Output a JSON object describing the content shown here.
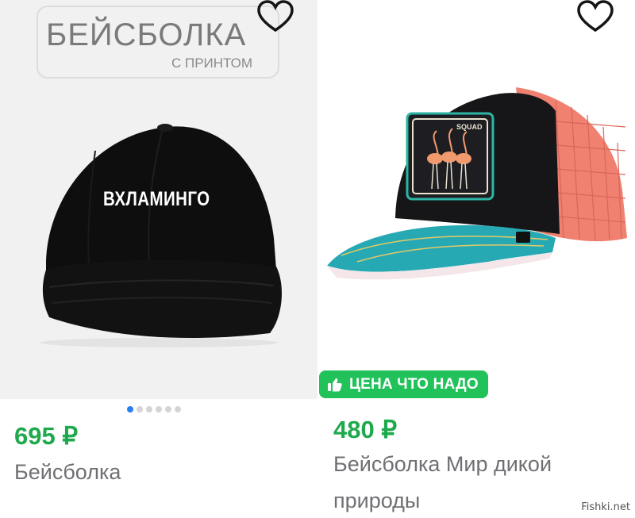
{
  "products": [
    {
      "banner_title": "БЕЙСБОЛКА",
      "banner_subtitle": "С ПРИНТОМ",
      "cap_print": "ВХЛАМИНГО",
      "price": "695 ₽",
      "title": "Бейсболка",
      "gallery_dots": 6,
      "gallery_active": 0,
      "favorite_icon": "heart-outline-icon"
    },
    {
      "patch_text": "SQUAD",
      "badge": "ЦЕНА ЧТО НАДО",
      "badge_icon": "thumbs-up-icon",
      "price": "480 ₽",
      "title_line1": "Бейсболка Мир дикой",
      "title_line2": "природы",
      "favorite_icon": "heart-outline-icon"
    }
  ],
  "watermark": "Fishki.net",
  "colors": {
    "price": "#1fa94d",
    "badge": "#21c25a",
    "dot_active": "#2a7ef0"
  }
}
